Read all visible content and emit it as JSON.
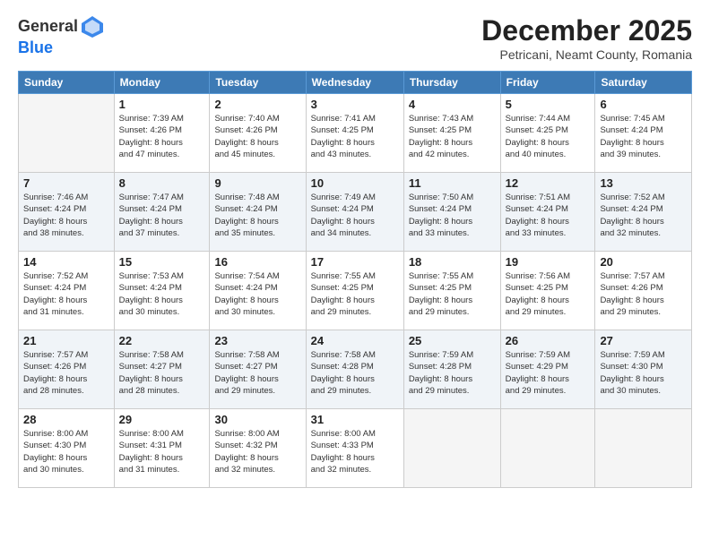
{
  "header": {
    "logo_line1": "General",
    "logo_line2": "Blue",
    "month": "December 2025",
    "location": "Petricani, Neamt County, Romania"
  },
  "weekdays": [
    "Sunday",
    "Monday",
    "Tuesday",
    "Wednesday",
    "Thursday",
    "Friday",
    "Saturday"
  ],
  "weeks": [
    [
      {
        "day": "",
        "info": ""
      },
      {
        "day": "1",
        "info": "Sunrise: 7:39 AM\nSunset: 4:26 PM\nDaylight: 8 hours\nand 47 minutes."
      },
      {
        "day": "2",
        "info": "Sunrise: 7:40 AM\nSunset: 4:26 PM\nDaylight: 8 hours\nand 45 minutes."
      },
      {
        "day": "3",
        "info": "Sunrise: 7:41 AM\nSunset: 4:25 PM\nDaylight: 8 hours\nand 43 minutes."
      },
      {
        "day": "4",
        "info": "Sunrise: 7:43 AM\nSunset: 4:25 PM\nDaylight: 8 hours\nand 42 minutes."
      },
      {
        "day": "5",
        "info": "Sunrise: 7:44 AM\nSunset: 4:25 PM\nDaylight: 8 hours\nand 40 minutes."
      },
      {
        "day": "6",
        "info": "Sunrise: 7:45 AM\nSunset: 4:24 PM\nDaylight: 8 hours\nand 39 minutes."
      }
    ],
    [
      {
        "day": "7",
        "info": "Sunrise: 7:46 AM\nSunset: 4:24 PM\nDaylight: 8 hours\nand 38 minutes."
      },
      {
        "day": "8",
        "info": "Sunrise: 7:47 AM\nSunset: 4:24 PM\nDaylight: 8 hours\nand 37 minutes."
      },
      {
        "day": "9",
        "info": "Sunrise: 7:48 AM\nSunset: 4:24 PM\nDaylight: 8 hours\nand 35 minutes."
      },
      {
        "day": "10",
        "info": "Sunrise: 7:49 AM\nSunset: 4:24 PM\nDaylight: 8 hours\nand 34 minutes."
      },
      {
        "day": "11",
        "info": "Sunrise: 7:50 AM\nSunset: 4:24 PM\nDaylight: 8 hours\nand 33 minutes."
      },
      {
        "day": "12",
        "info": "Sunrise: 7:51 AM\nSunset: 4:24 PM\nDaylight: 8 hours\nand 33 minutes."
      },
      {
        "day": "13",
        "info": "Sunrise: 7:52 AM\nSunset: 4:24 PM\nDaylight: 8 hours\nand 32 minutes."
      }
    ],
    [
      {
        "day": "14",
        "info": "Sunrise: 7:52 AM\nSunset: 4:24 PM\nDaylight: 8 hours\nand 31 minutes."
      },
      {
        "day": "15",
        "info": "Sunrise: 7:53 AM\nSunset: 4:24 PM\nDaylight: 8 hours\nand 30 minutes."
      },
      {
        "day": "16",
        "info": "Sunrise: 7:54 AM\nSunset: 4:24 PM\nDaylight: 8 hours\nand 30 minutes."
      },
      {
        "day": "17",
        "info": "Sunrise: 7:55 AM\nSunset: 4:25 PM\nDaylight: 8 hours\nand 29 minutes."
      },
      {
        "day": "18",
        "info": "Sunrise: 7:55 AM\nSunset: 4:25 PM\nDaylight: 8 hours\nand 29 minutes."
      },
      {
        "day": "19",
        "info": "Sunrise: 7:56 AM\nSunset: 4:25 PM\nDaylight: 8 hours\nand 29 minutes."
      },
      {
        "day": "20",
        "info": "Sunrise: 7:57 AM\nSunset: 4:26 PM\nDaylight: 8 hours\nand 29 minutes."
      }
    ],
    [
      {
        "day": "21",
        "info": "Sunrise: 7:57 AM\nSunset: 4:26 PM\nDaylight: 8 hours\nand 28 minutes."
      },
      {
        "day": "22",
        "info": "Sunrise: 7:58 AM\nSunset: 4:27 PM\nDaylight: 8 hours\nand 28 minutes."
      },
      {
        "day": "23",
        "info": "Sunrise: 7:58 AM\nSunset: 4:27 PM\nDaylight: 8 hours\nand 29 minutes."
      },
      {
        "day": "24",
        "info": "Sunrise: 7:58 AM\nSunset: 4:28 PM\nDaylight: 8 hours\nand 29 minutes."
      },
      {
        "day": "25",
        "info": "Sunrise: 7:59 AM\nSunset: 4:28 PM\nDaylight: 8 hours\nand 29 minutes."
      },
      {
        "day": "26",
        "info": "Sunrise: 7:59 AM\nSunset: 4:29 PM\nDaylight: 8 hours\nand 29 minutes."
      },
      {
        "day": "27",
        "info": "Sunrise: 7:59 AM\nSunset: 4:30 PM\nDaylight: 8 hours\nand 30 minutes."
      }
    ],
    [
      {
        "day": "28",
        "info": "Sunrise: 8:00 AM\nSunset: 4:30 PM\nDaylight: 8 hours\nand 30 minutes."
      },
      {
        "day": "29",
        "info": "Sunrise: 8:00 AM\nSunset: 4:31 PM\nDaylight: 8 hours\nand 31 minutes."
      },
      {
        "day": "30",
        "info": "Sunrise: 8:00 AM\nSunset: 4:32 PM\nDaylight: 8 hours\nand 32 minutes."
      },
      {
        "day": "31",
        "info": "Sunrise: 8:00 AM\nSunset: 4:33 PM\nDaylight: 8 hours\nand 32 minutes."
      },
      {
        "day": "",
        "info": ""
      },
      {
        "day": "",
        "info": ""
      },
      {
        "day": "",
        "info": ""
      }
    ]
  ]
}
